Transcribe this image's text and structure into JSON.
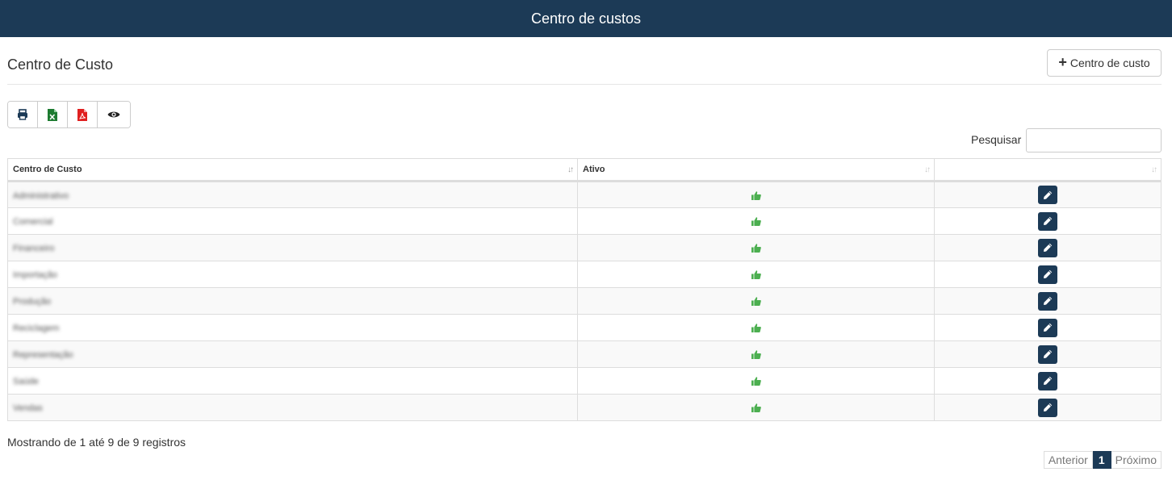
{
  "header": {
    "title": "Centro de custos"
  },
  "page": {
    "title": "Centro de Custo"
  },
  "actions": {
    "add_label": "Centro de custo"
  },
  "toolbar": {
    "buttons": [
      {
        "icon": "print-icon",
        "color": "#1c3a56"
      },
      {
        "icon": "excel-icon",
        "color": "#1d7b30"
      },
      {
        "icon": "pdf-icon",
        "color": "#e02020"
      },
      {
        "icon": "eye-icon",
        "color": "#222222"
      }
    ]
  },
  "search": {
    "label": "Pesquisar",
    "value": ""
  },
  "table": {
    "columns": [
      "Centro de Custo",
      "Ativo",
      ""
    ],
    "rows": [
      {
        "name": "Administrativo",
        "active": true
      },
      {
        "name": "Comercial",
        "active": true
      },
      {
        "name": "Financeiro",
        "active": true
      },
      {
        "name": "Importação",
        "active": true
      },
      {
        "name": "Produção",
        "active": true
      },
      {
        "name": "Reciclagem",
        "active": true
      },
      {
        "name": "Representação",
        "active": true
      },
      {
        "name": "Saúde",
        "active": true
      },
      {
        "name": "Vendas",
        "active": true
      }
    ]
  },
  "footer": {
    "info": "Mostrando de 1 até 9 de 9 registros",
    "prev_label": "Anterior",
    "current_page": "1",
    "next_label": "Próximo"
  },
  "colors": {
    "primary": "#1c3a56",
    "thumb": "#4caf50"
  }
}
